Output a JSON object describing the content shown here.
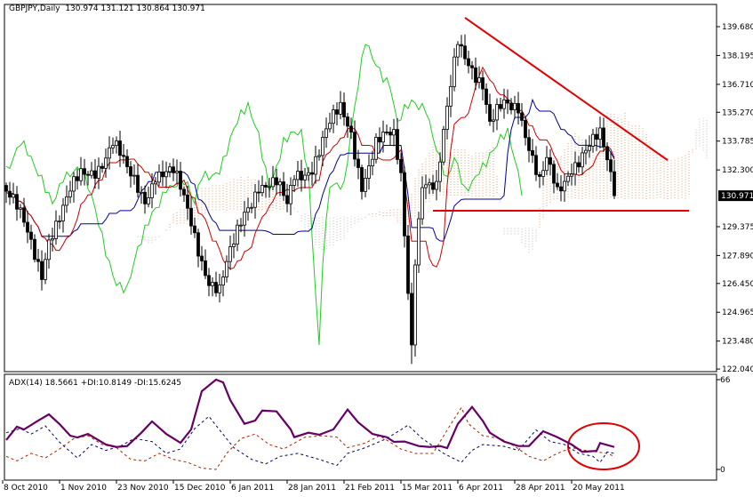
{
  "header": {
    "symbol": "GBPJPY,Daily",
    "open": "130.974",
    "high": "131.121",
    "low": "130.864",
    "close": "130.971"
  },
  "adx_header": {
    "label": "ADX(14)",
    "adx": "18.5661",
    "plus_di": "+DI:10.8149",
    "minus_di": "-DI:15.6245"
  },
  "chart_data": [
    {
      "type": "candlestick",
      "title": "GBPJPY,Daily",
      "indicator": "Ichimoku (9,26,52)",
      "ylim": [
        122.04,
        140.3
      ],
      "y_ticks": [
        "139.680",
        "138.195",
        "136.710",
        "135.270",
        "133.785",
        "132.300",
        "129.375",
        "127.890",
        "126.450",
        "124.965",
        "123.480",
        "122.040"
      ],
      "current_price_label": "130.971",
      "x_labels": [
        {
          "bar": 0,
          "label": "8 Oct 2010"
        },
        {
          "bar": 16,
          "label": "1 Nov 2010"
        },
        {
          "bar": 32,
          "label": "23 Nov 2010"
        },
        {
          "bar": 48,
          "label": "15 Dec 2010"
        },
        {
          "bar": 64,
          "label": "6 Jan 2011"
        },
        {
          "bar": 80,
          "label": "28 Jan 2011"
        },
        {
          "bar": 96,
          "label": "21 Feb 2011"
        },
        {
          "bar": 112,
          "label": "15 Mar 2011"
        },
        {
          "bar": 128,
          "label": "6 Apr 2011"
        },
        {
          "bar": 144,
          "label": "28 Apr 2011"
        },
        {
          "bar": 160,
          "label": "20 May 2011"
        }
      ],
      "close_waypoints": [
        [
          0,
          131.2
        ],
        [
          4,
          129.6
        ],
        [
          10,
          127.3
        ],
        [
          12,
          129.1
        ],
        [
          16,
          130.1
        ],
        [
          21,
          131.9
        ],
        [
          26,
          132.8
        ],
        [
          30,
          133.7
        ],
        [
          34,
          131.9
        ],
        [
          39,
          131.0
        ],
        [
          42,
          132.4
        ],
        [
          47,
          131.9
        ],
        [
          52,
          129.6
        ],
        [
          57,
          126.9
        ],
        [
          60,
          126.0
        ],
        [
          64,
          128.2
        ],
        [
          67,
          130.1
        ],
        [
          71,
          131.9
        ],
        [
          76,
          131.4
        ],
        [
          79,
          130.1
        ],
        [
          81,
          131.9
        ],
        [
          86,
          132.8
        ],
        [
          90,
          134.2
        ],
        [
          94,
          135.1
        ],
        [
          97,
          134.2
        ],
        [
          100,
          131.9
        ],
        [
          104,
          133.7
        ],
        [
          109,
          133.7
        ],
        [
          111,
          131.9
        ],
        [
          114,
          123.6
        ],
        [
          115,
          128.2
        ],
        [
          117,
          131.9
        ],
        [
          121,
          131.0
        ],
        [
          125,
          136.5
        ],
        [
          127,
          139.2
        ],
        [
          130,
          138.3
        ],
        [
          134,
          136.5
        ],
        [
          136,
          134.2
        ],
        [
          140,
          135.6
        ],
        [
          144,
          136.0
        ],
        [
          147,
          133.7
        ],
        [
          150,
          131.4
        ],
        [
          152,
          132.4
        ],
        [
          155,
          131.0
        ],
        [
          159,
          132.8
        ],
        [
          162,
          133.3
        ],
        [
          167,
          133.7
        ],
        [
          170,
          131.9
        ],
        [
          171,
          130.97
        ]
      ],
      "ichimoku": {
        "tenkan": 9,
        "kijun": 26,
        "senkou_b": 52,
        "shift": 26,
        "colors": {
          "tenkan": "#cc0000",
          "kijun": "#000099",
          "chikou": "#22cc22",
          "cloud_up": "#d9a070",
          "cloud_down": "#bbbbbb"
        }
      },
      "annotations": {
        "trendline": {
          "from": [
            129,
            140.14
          ],
          "to": [
            186,
            132.8
          ],
          "color": "#e00000"
        },
        "support": {
          "from": 120,
          "to": 192,
          "price": 130.2,
          "color": "#e00000"
        }
      }
    },
    {
      "type": "line",
      "title": "ADX(14)",
      "ylim": [
        0,
        66
      ],
      "y_ticks": [
        "66",
        "0"
      ],
      "series": [
        {
          "name": "ADX",
          "color": "#660066",
          "points": [
            [
              0,
              21.6
            ],
            [
              3,
              31.4
            ],
            [
              5,
              29.4
            ],
            [
              9,
              35.9
            ],
            [
              12,
              40.5
            ],
            [
              15,
              33.3
            ],
            [
              18,
              24.8
            ],
            [
              20,
              23.5
            ],
            [
              23,
              26.1
            ],
            [
              28,
              18.3
            ],
            [
              31,
              16.5
            ],
            [
              34,
              17.2
            ],
            [
              38,
              27
            ],
            [
              41,
              35.3
            ],
            [
              45,
              26.1
            ],
            [
              49,
              19.6
            ],
            [
              52,
              29.4
            ],
            [
              55,
              57.5
            ],
            [
              59,
              66
            ],
            [
              61,
              64
            ],
            [
              63,
              51
            ],
            [
              67,
              33.5
            ],
            [
              70,
              35.9
            ],
            [
              72,
              43.3
            ],
            [
              76,
              42.7
            ],
            [
              80,
              29.4
            ],
            [
              81,
              23.7
            ],
            [
              85,
              27
            ],
            [
              88,
              25.5
            ],
            [
              92,
              29.4
            ],
            [
              96,
              44
            ],
            [
              99,
              34.6
            ],
            [
              103,
              26.1
            ],
            [
              107,
              23.7
            ],
            [
              109,
              20.3
            ],
            [
              112,
              20.5
            ],
            [
              116,
              17.2
            ],
            [
              119,
              16.5
            ],
            [
              122,
              17.2
            ],
            [
              124,
              15.7
            ],
            [
              127,
              33.5
            ],
            [
              131,
              45.9
            ],
            [
              134,
              35.7
            ],
            [
              136,
              27
            ],
            [
              140,
              20.5
            ],
            [
              144,
              17.2
            ],
            [
              147,
              17.2
            ],
            [
              151,
              28.1
            ],
            [
              155,
              23.7
            ],
            [
              159,
              18.3
            ],
            [
              162,
              12.9
            ],
            [
              166,
              13.7
            ],
            [
              167,
              19.4
            ],
            [
              171,
              16.5
            ]
          ]
        },
        {
          "name": "+DI",
          "color": "#000066",
          "points": [
            [
              0,
              27
            ],
            [
              4,
              30
            ],
            [
              7,
              26
            ],
            [
              11,
              32
            ],
            [
              15,
              20
            ],
            [
              20,
              8.5
            ],
            [
              24,
              18.3
            ],
            [
              28,
              14
            ],
            [
              32,
              17
            ],
            [
              36,
              22.7
            ],
            [
              41,
              20.5
            ],
            [
              45,
              11.8
            ],
            [
              49,
              15
            ],
            [
              53,
              30
            ],
            [
              57,
              39
            ],
            [
              60,
              29
            ],
            [
              64,
              16
            ],
            [
              69,
              7.4
            ],
            [
              73,
              4.1
            ],
            [
              77,
              9.6
            ],
            [
              82,
              11.8
            ],
            [
              88,
              7.4
            ],
            [
              93,
              3
            ],
            [
              96,
              11.8
            ],
            [
              101,
              16
            ],
            [
              107,
              22.7
            ],
            [
              113,
              32.5
            ],
            [
              117,
              22.7
            ],
            [
              123,
              11.8
            ],
            [
              128,
              5.2
            ],
            [
              131,
              14
            ],
            [
              134,
              18.3
            ],
            [
              140,
              17
            ],
            [
              144,
              14
            ],
            [
              149,
              29
            ],
            [
              153,
              20.5
            ],
            [
              157,
              18.3
            ],
            [
              161,
              11.8
            ],
            [
              165,
              9.6
            ],
            [
              167,
              5.2
            ],
            [
              169,
              12.9
            ],
            [
              171,
              11.8
            ]
          ]
        },
        {
          "name": "-DI",
          "color": "#aa2200",
          "points": [
            [
              0,
              9.6
            ],
            [
              3,
              6.3
            ],
            [
              7,
              11.8
            ],
            [
              11,
              8.5
            ],
            [
              15,
              15
            ],
            [
              19,
              22.7
            ],
            [
              23,
              24.8
            ],
            [
              27,
              18.3
            ],
            [
              31,
              16
            ],
            [
              35,
              7.4
            ],
            [
              39,
              6.3
            ],
            [
              43,
              11.8
            ],
            [
              47,
              7.4
            ],
            [
              51,
              5.2
            ],
            [
              55,
              0.9
            ],
            [
              59,
              0
            ],
            [
              62,
              11.8
            ],
            [
              66,
              22.7
            ],
            [
              70,
              26
            ],
            [
              74,
              18.3
            ],
            [
              78,
              15
            ],
            [
              84,
              23.7
            ],
            [
              89,
              24.8
            ],
            [
              93,
              23.7
            ],
            [
              96,
              16
            ],
            [
              101,
              19.4
            ],
            [
              105,
              24.8
            ],
            [
              111,
              15
            ],
            [
              115,
              11.8
            ],
            [
              120,
              11.8
            ],
            [
              124,
              29
            ],
            [
              128,
              45.5
            ],
            [
              130,
              33.5
            ],
            [
              134,
              24.8
            ],
            [
              139,
              22.7
            ],
            [
              143,
              17
            ],
            [
              147,
              9.6
            ],
            [
              151,
              6.3
            ],
            [
              155,
              11.8
            ],
            [
              159,
              16
            ],
            [
              163,
              14
            ],
            [
              169,
              11.8
            ],
            [
              171,
              9.6
            ]
          ]
        }
      ],
      "annotations": {
        "ellipse": {
          "center": [
            168,
            17
          ],
          "radius_bars": 10,
          "radius_value": 17,
          "color": "#e00000"
        }
      }
    }
  ]
}
